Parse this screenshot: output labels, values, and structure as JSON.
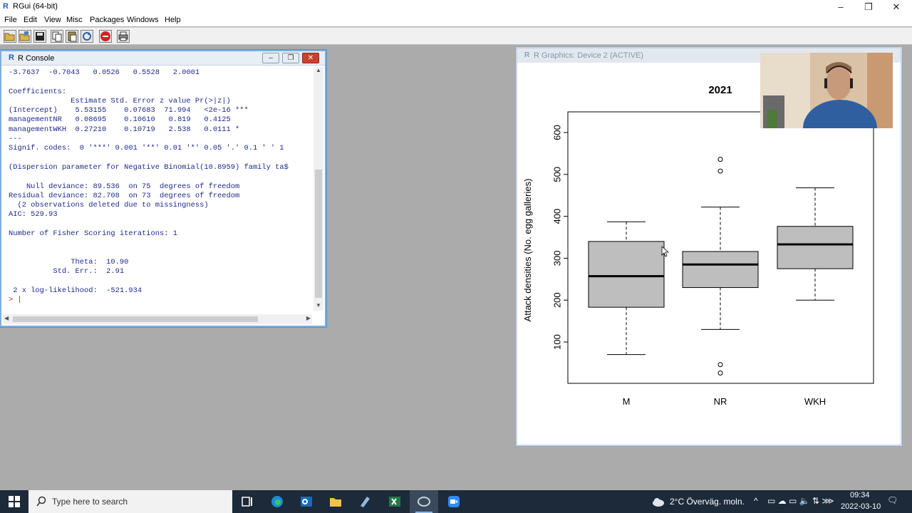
{
  "app": {
    "title": "RGui (64-bit)",
    "window_controls": [
      "–",
      "❐",
      "✕"
    ]
  },
  "menu": [
    "File",
    "Edit",
    "View",
    "Misc",
    "Packages",
    "Windows",
    "Help"
  ],
  "toolbar": {
    "buttons": [
      "open-script",
      "load-workspace",
      "save-workspace",
      "copy",
      "paste",
      "copy-paste",
      "stop",
      "print"
    ]
  },
  "console": {
    "title": "R Console",
    "lines": [
      "-3.7637  -0.7043   0.0526   0.5528   2.0001",
      "",
      "Coefficients:",
      "              Estimate Std. Error z value Pr(>|z|)",
      "(Intercept)    5.53155    0.07683  71.994   <2e-16 ***",
      "managementNR   0.08695    0.10610   0.819   0.4125",
      "managementWKH  0.27210    0.10719   2.538   0.0111 *",
      "---",
      "Signif. codes:  0 '***' 0.001 '**' 0.01 '*' 0.05 '.' 0.1 ' ' 1",
      "",
      "(Dispersion parameter for Negative Binomial(10.8959) family ta$",
      "",
      "    Null deviance: 89.536  on 75  degrees of freedom",
      "Residual deviance: 82.708  on 73  degrees of freedom",
      "  (2 observations deleted due to missingness)",
      "AIC: 529.93",
      "",
      "Number of Fisher Scoring iterations: 1",
      "",
      "",
      "              Theta:  10.90",
      "          Std. Err.:  2.91",
      "",
      " 2 x log-likelihood:  -521.934"
    ],
    "prompt": ">"
  },
  "graphics": {
    "title": "R Graphics: Device 2 (ACTIVE)"
  },
  "chart_data": {
    "type": "boxplot",
    "title": "2021",
    "xlabel": "",
    "ylabel": "Attack densities (No. egg galleries)",
    "ylim": [
      0,
      650
    ],
    "yticks": [
      100,
      200,
      300,
      400,
      500,
      600
    ],
    "categories": [
      "M",
      "NR",
      "WKH"
    ],
    "boxes": [
      {
        "name": "M",
        "whisker_low": 70,
        "q1": 183,
        "median": 257,
        "q3": 340,
        "whisker_high": 387,
        "outliers": []
      },
      {
        "name": "NR",
        "whisker_low": 130,
        "q1": 230,
        "median": 285,
        "q3": 316,
        "whisker_high": 422,
        "outliers": [
          46,
          26,
          508,
          536
        ]
      },
      {
        "name": "WKH",
        "whisker_low": 200,
        "q1": 275,
        "median": 333,
        "q3": 376,
        "whisker_high": 468,
        "outliers": []
      }
    ],
    "box_color": "#bebebe"
  },
  "taskbar": {
    "search_placeholder": "Type here to search",
    "weather": "2°C  Överväg. moln.",
    "time": "09:34",
    "date": "2022-03-10"
  }
}
